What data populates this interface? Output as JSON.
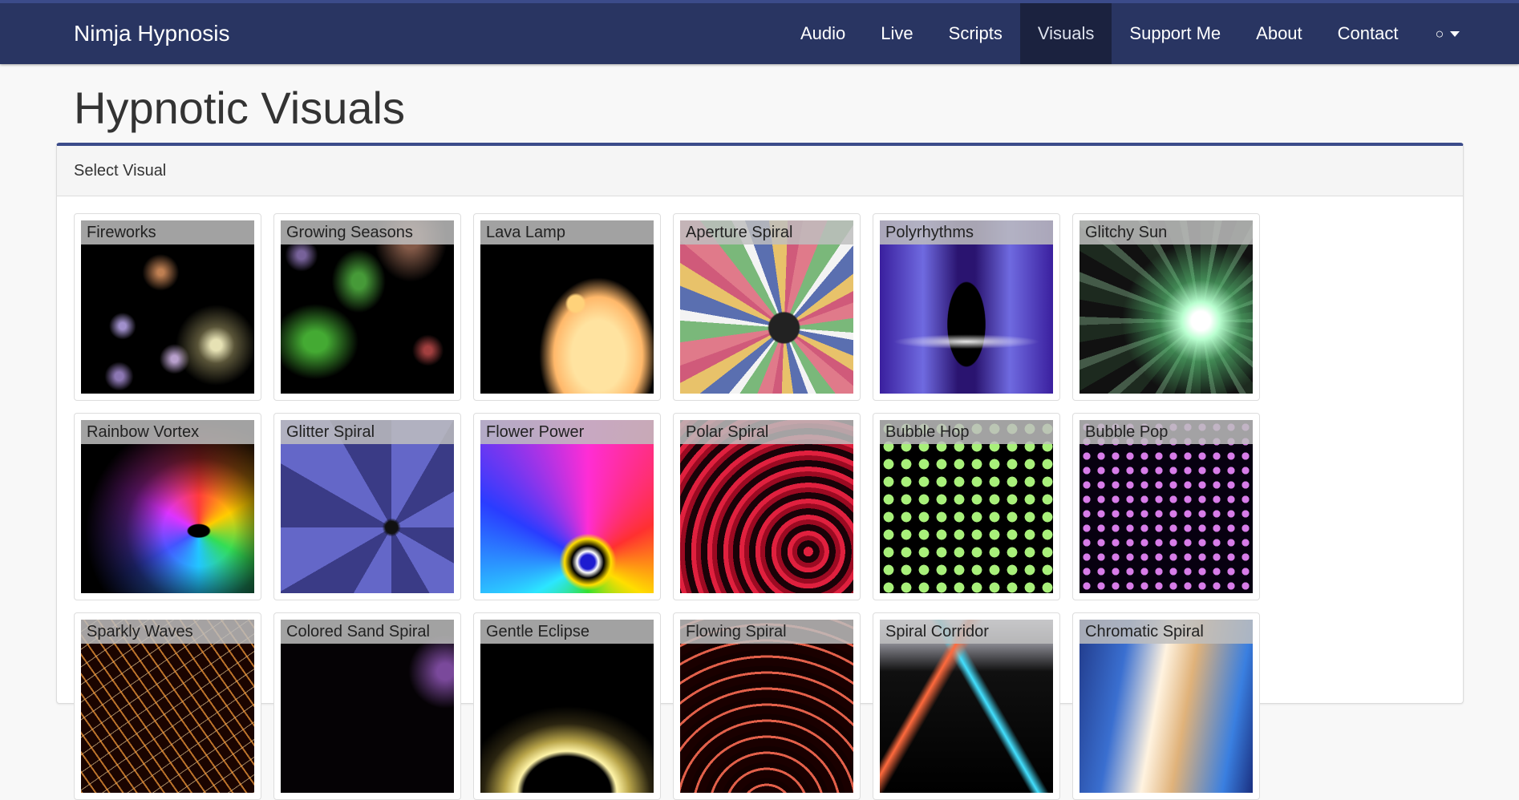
{
  "navbar": {
    "brand": "Nimja Hypnosis",
    "items": [
      {
        "label": "Audio",
        "active": false
      },
      {
        "label": "Live",
        "active": false
      },
      {
        "label": "Scripts",
        "active": false
      },
      {
        "label": "Visuals",
        "active": true
      },
      {
        "label": "Support Me",
        "active": false
      },
      {
        "label": "About",
        "active": false
      },
      {
        "label": "Contact",
        "active": false
      }
    ],
    "user_icon": "○",
    "user_icon_name": "user-circle-icon",
    "caret_icon_name": "caret-down-icon"
  },
  "page": {
    "title": "Hypnotic Visuals"
  },
  "panel": {
    "heading": "Select Visual",
    "visuals": [
      {
        "name": "Fireworks",
        "art": "fireworks"
      },
      {
        "name": "Growing Seasons",
        "art": "seasons"
      },
      {
        "name": "Lava Lamp",
        "art": "lava"
      },
      {
        "name": "Aperture Spiral",
        "art": "aperture"
      },
      {
        "name": "Polyrhythms",
        "art": "poly"
      },
      {
        "name": "Glitchy Sun",
        "art": "sun"
      },
      {
        "name": "Rainbow Vortex",
        "art": "rainbow"
      },
      {
        "name": "Glitter Spiral",
        "art": "glitter"
      },
      {
        "name": "Flower Power",
        "art": "flower"
      },
      {
        "name": "Polar Spiral",
        "art": "polar"
      },
      {
        "name": "Bubble Hop",
        "art": "bubblehop"
      },
      {
        "name": "Bubble Pop",
        "art": "bubblepop"
      },
      {
        "name": "Sparkly Waves",
        "art": "sparkly"
      },
      {
        "name": "Colored Sand Spiral",
        "art": "sand"
      },
      {
        "name": "Gentle Eclipse",
        "art": "eclipse"
      },
      {
        "name": "Flowing Spiral",
        "art": "flowing"
      },
      {
        "name": "Spiral Corridor",
        "art": "corridor"
      },
      {
        "name": "Chromatic Spiral",
        "art": "chromatic"
      }
    ]
  },
  "colors": {
    "navbar_bg": "#293562",
    "navbar_active_bg": "#1b223f",
    "accent": "#3b4b8a",
    "page_bg": "#f8f8f8"
  }
}
